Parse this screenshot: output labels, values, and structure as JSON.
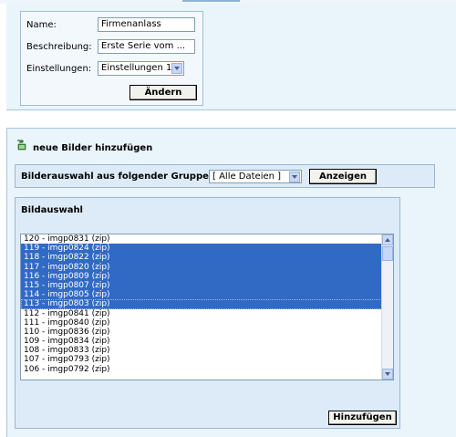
{
  "form": {
    "name_label": "Name:",
    "name_value": "Firmenanlass",
    "description_label": "Beschreibung:",
    "description_value": "Erste Serie vom ...",
    "settings_label": "Einstellungen:",
    "settings_value": "Einstellungen 1",
    "change_button": "Ändern"
  },
  "add_images": {
    "title": "neue Bilder hinzufügen",
    "group_label": "Bilderauswahl aus folgender Gruppe:",
    "group_value": "[ Alle Dateien ]",
    "show_button": "Anzeigen"
  },
  "selection": {
    "title": "Bildauswahl",
    "items": [
      {
        "label": "120 - imgp0831 (zip)",
        "selected": false
      },
      {
        "label": "119 - imgp0824 (zip)",
        "selected": true
      },
      {
        "label": "118 - imgp0822 (zip)",
        "selected": true
      },
      {
        "label": "117 - imgp0820 (zip)",
        "selected": true
      },
      {
        "label": "116 - imgp0809 (zip)",
        "selected": true
      },
      {
        "label": "115 - imgp0807 (zip)",
        "selected": true
      },
      {
        "label": "114 - imgp0805 (zip)",
        "selected": true
      },
      {
        "label": "113 - imgp0803 (zip)",
        "selected": true,
        "focused": true
      },
      {
        "label": "112 - imgp0841 (zip)",
        "selected": false
      },
      {
        "label": "111 - imgp0840 (zip)",
        "selected": false
      },
      {
        "label": "110 - imgp0836 (zip)",
        "selected": false
      },
      {
        "label": "109 - imgp0834 (zip)",
        "selected": false
      },
      {
        "label": "108 - imgp0833 (zip)",
        "selected": false
      },
      {
        "label": "107 - imgp0793 (zip)",
        "selected": false
      },
      {
        "label": "106 - imgp0792 (zip)",
        "selected": false
      }
    ],
    "add_button": "Hinzufügen"
  },
  "icons": {
    "add_images": "add-image-icon",
    "dropdown": "chevron-down-icon",
    "scroll_up": "scroll-up-icon",
    "scroll_down": "scroll-down-icon"
  },
  "colors": {
    "panel_bg": "#eaf4fb",
    "box_bg": "#dcebf7",
    "selection": "#316ac5",
    "border": "#98b8d4"
  }
}
